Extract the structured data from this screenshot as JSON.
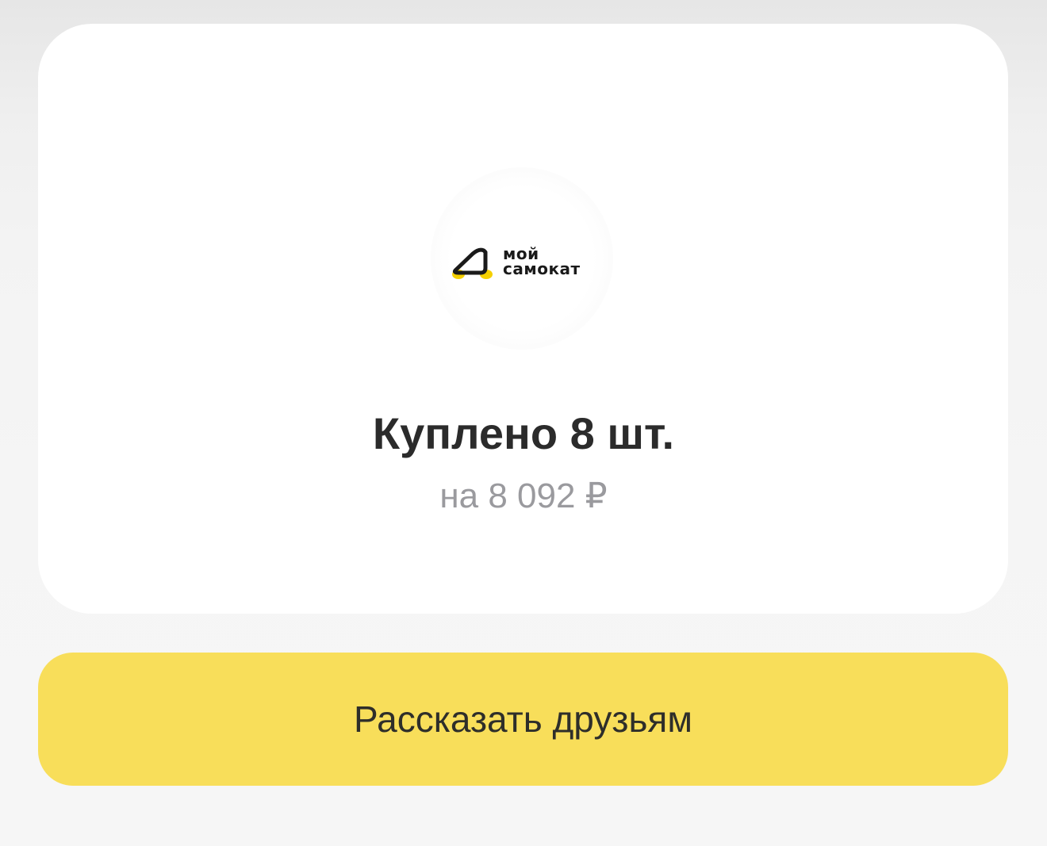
{
  "brand": {
    "line1": "мой",
    "line2": "самокат",
    "logo_icon": "samokat-logo-icon",
    "colors": {
      "accent": "#f8de5a",
      "logo_yellow": "#f5d000",
      "text_dark": "#2b2b2b",
      "text_muted": "#9a9a9e"
    }
  },
  "summary": {
    "title": "Куплено 8 шт.",
    "amount": "на 8 092 ₽"
  },
  "actions": {
    "share_label": "Рассказать друзьям"
  }
}
